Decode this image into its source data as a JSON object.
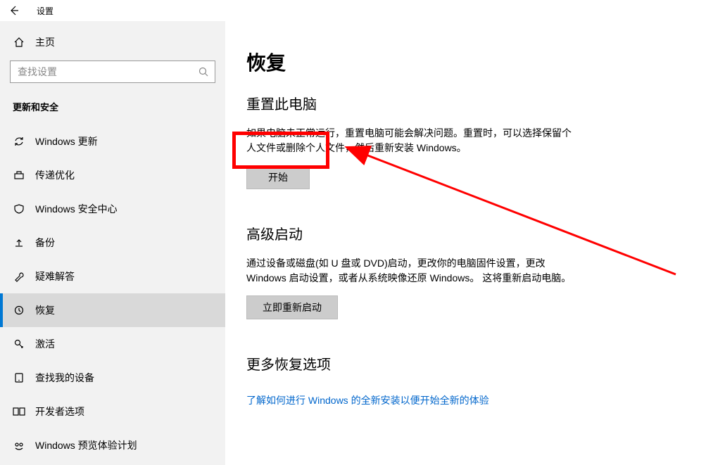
{
  "titlebar": {
    "app_title": "设置"
  },
  "sidebar": {
    "home_label": "主页",
    "search_placeholder": "查找设置",
    "category": "更新和安全",
    "items": [
      {
        "label": "Windows 更新",
        "icon": "sync"
      },
      {
        "label": "传递优化",
        "icon": "delivery"
      },
      {
        "label": "Windows 安全中心",
        "icon": "shield"
      },
      {
        "label": "备份",
        "icon": "backup"
      },
      {
        "label": "疑难解答",
        "icon": "troubleshoot"
      },
      {
        "label": "恢复",
        "icon": "recovery",
        "active": true
      },
      {
        "label": "激活",
        "icon": "activation"
      },
      {
        "label": "查找我的设备",
        "icon": "find-device"
      },
      {
        "label": "开发者选项",
        "icon": "developer"
      },
      {
        "label": "Windows 预览体验计划",
        "icon": "insider"
      }
    ]
  },
  "content": {
    "page_title": "恢复",
    "reset": {
      "heading": "重置此电脑",
      "desc": "如果电脑未正常运行，重置电脑可能会解决问题。重置时，可以选择保留个人文件或删除个人文件，然后重新安装 Windows。",
      "button": "开始"
    },
    "advanced": {
      "heading": "高级启动",
      "desc": "通过设备或磁盘(如 U 盘或 DVD)启动，更改你的电脑固件设置，更改 Windows 启动设置，或者从系统映像还原 Windows。 这将重新启动电脑。",
      "button": "立即重新启动"
    },
    "more": {
      "heading": "更多恢复选项",
      "link": "了解如何进行 Windows 的全新安装以便开始全新的体验"
    }
  },
  "annotation": {
    "highlight_color": "#ff0000"
  }
}
